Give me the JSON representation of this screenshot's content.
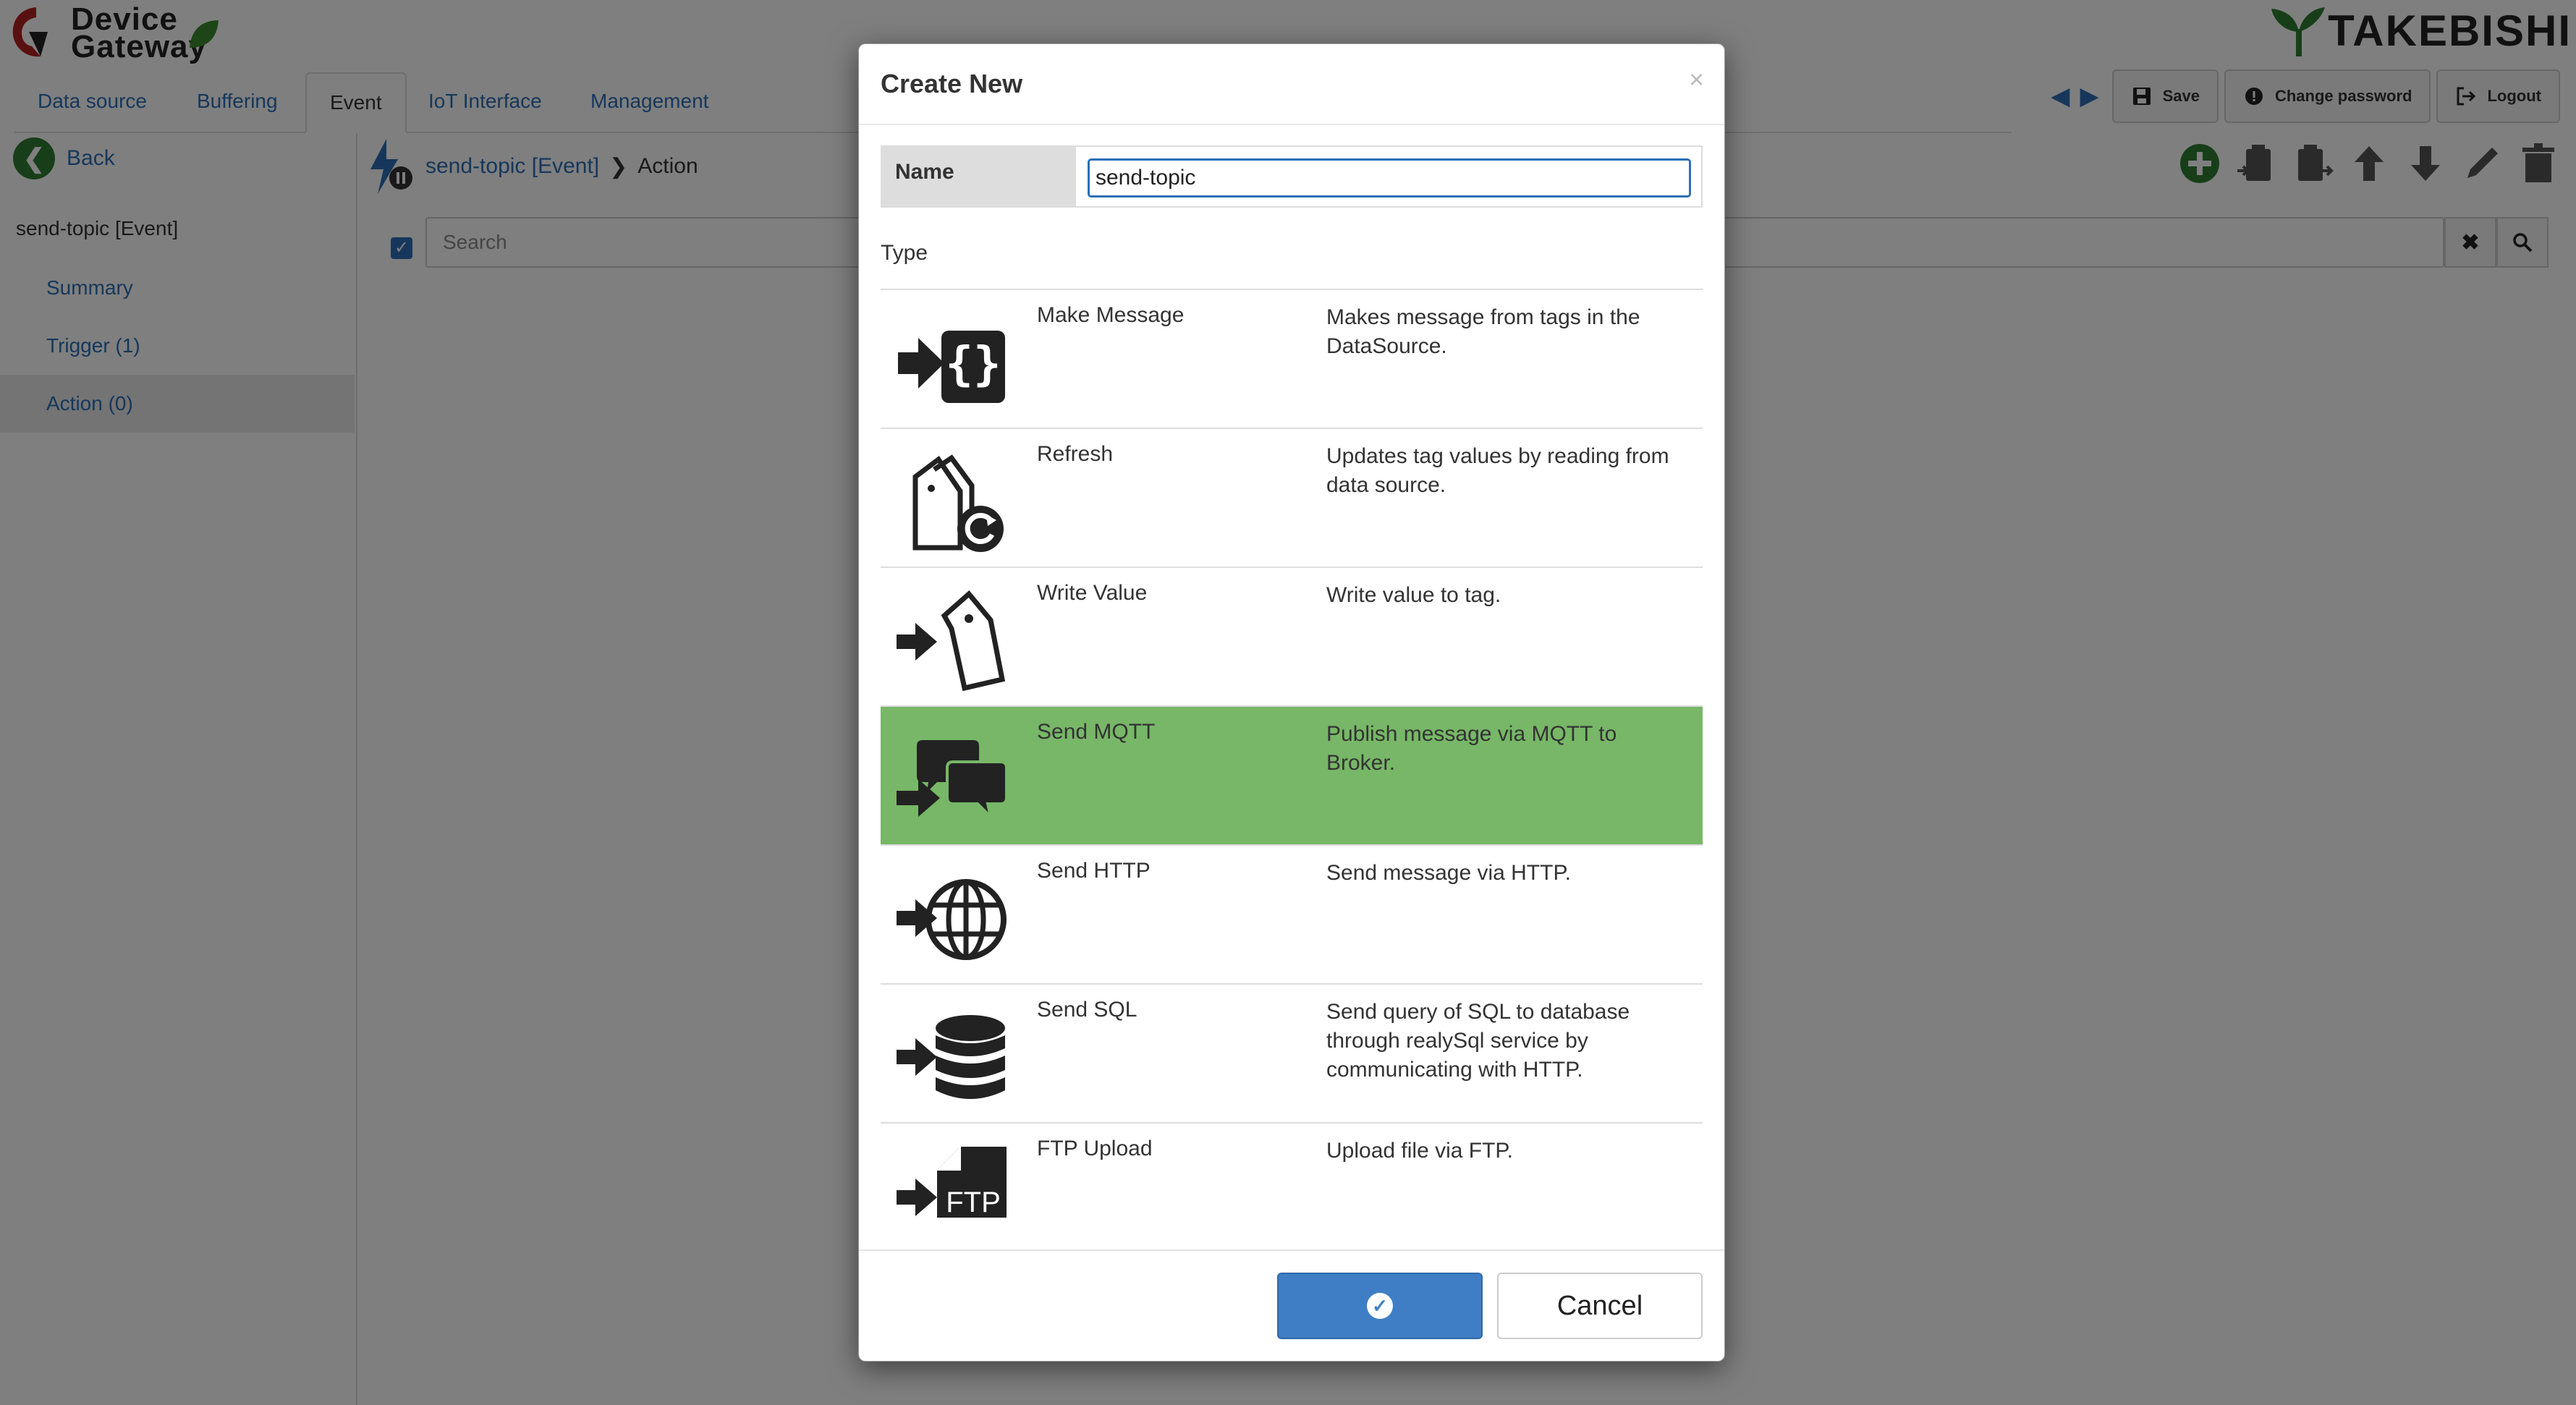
{
  "app": {
    "logo_text_line1": "Device",
    "logo_text_line2": "Gateway",
    "brand_text": "TAKEBISHI",
    "accent_color": "#2c6fb7"
  },
  "tabs": [
    {
      "label": "Data source"
    },
    {
      "label": "Buffering"
    },
    {
      "label": "Event"
    },
    {
      "label": "IoT Interface"
    },
    {
      "label": "Management"
    }
  ],
  "top_buttons": {
    "save": "Save",
    "change_password": "Change password",
    "logout": "Logout"
  },
  "sidebar": {
    "back": "Back",
    "title": "send-topic  [Event]",
    "items": [
      {
        "label": "Summary"
      },
      {
        "label": "Trigger (1)"
      },
      {
        "label": "Action (0)"
      }
    ]
  },
  "breadcrumb": {
    "event": "send-topic  [Event]",
    "current": "Action"
  },
  "search": {
    "placeholder": "Search"
  },
  "modal": {
    "title": "Create New",
    "close": "×",
    "name_label": "Name",
    "name_value": "send-topic",
    "type_label": "Type",
    "types": [
      {
        "name": "Make Message",
        "desc": "Makes message from tags in the DataSource.",
        "icon": "make-message-icon"
      },
      {
        "name": "Refresh",
        "desc": "Updates tag values by reading from data source.",
        "icon": "refresh-tags-icon"
      },
      {
        "name": "Write Value",
        "desc": "Write value to tag.",
        "icon": "write-value-icon"
      },
      {
        "name": "Send MQTT",
        "desc": "Publish message via MQTT to Broker.",
        "icon": "send-mqtt-icon",
        "selected": true
      },
      {
        "name": "Send HTTP",
        "desc": "Send message via HTTP.",
        "icon": "send-http-icon"
      },
      {
        "name": "Send SQL",
        "desc": "Send query of SQL to database through realySql service by communicating with HTTP.",
        "icon": "send-sql-icon"
      },
      {
        "name": "FTP Upload",
        "desc": "Upload file via FTP.",
        "icon": "ftp-upload-icon"
      }
    ],
    "ftp_icon_text": "FTP",
    "cancel": "Cancel",
    "selected_color": "#77b767"
  }
}
